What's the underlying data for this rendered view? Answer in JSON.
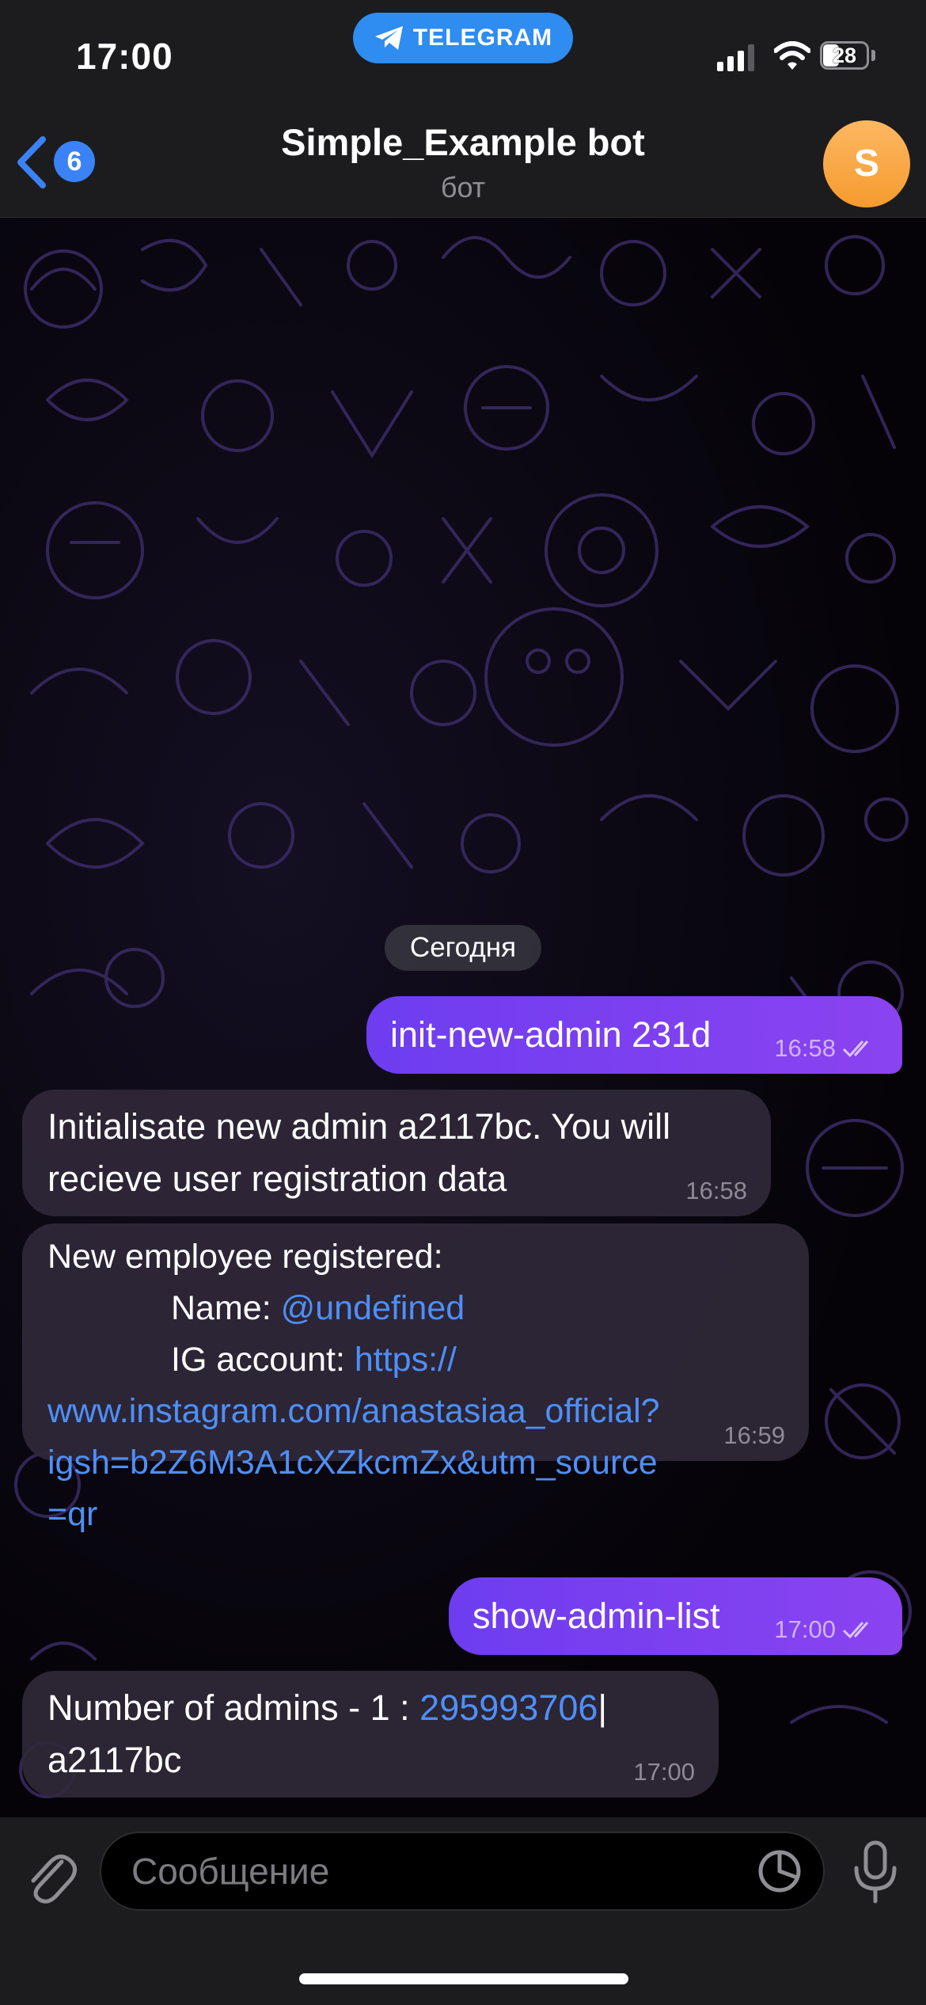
{
  "status_bar": {
    "time": "17:00",
    "app_pill": "TELEGRAM",
    "battery": "28",
    "icons": [
      "telegram-icon",
      "signal-icon",
      "wifi-icon",
      "battery-icon"
    ]
  },
  "header": {
    "back_badge": "6",
    "title": "Simple_Example bot",
    "subtitle": "бот",
    "avatar_letter": "S",
    "avatar_color": "#f7a53b"
  },
  "chat": {
    "date_separator": "Сегодня",
    "messages": [
      {
        "direction": "out",
        "text": "init-new-admin 231d",
        "time": "16:58",
        "status": "read"
      },
      {
        "direction": "in",
        "line1": "Initialisate new admin a2117bc. You will",
        "line2": "recieve user registration data",
        "time": "16:58"
      },
      {
        "direction": "in",
        "heading": "New employee registered:",
        "name_label": "Name: ",
        "name_value": "@undefined",
        "ig_label": "IG account: ",
        "ig_link_line1": "https://",
        "ig_link_line2": "www.instagram.com/anastasiaa_official?",
        "ig_link_line3": "igsh=b2Z6M3A1cXZkcmZx&utm_source",
        "ig_link_line4": "=qr",
        "time": "16:59"
      },
      {
        "direction": "out",
        "text": "show-admin-list",
        "time": "17:00",
        "status": "read"
      },
      {
        "direction": "in",
        "prefix": "Number of admins - 1 : ",
        "id_link": "295993706",
        "separator": "|",
        "line2": "a2117bc",
        "time": "17:00"
      }
    ]
  },
  "input_bar": {
    "placeholder": "Сообщение",
    "icons": [
      "paperclip-icon",
      "sticker-icon",
      "microphone-icon"
    ]
  },
  "colors": {
    "accent": "#3b82f6",
    "outgoing_bubble": "#7b42f0",
    "incoming_bubble": "#302838",
    "link": "#4f8ff7"
  }
}
